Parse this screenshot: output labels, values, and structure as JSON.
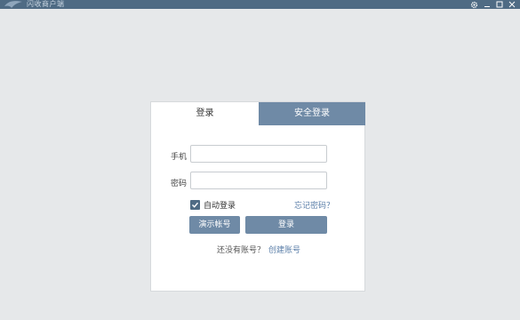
{
  "window": {
    "title": "闪收商户端",
    "controls": [
      "gear-icon",
      "minimize-icon",
      "maximize-icon",
      "close-icon"
    ]
  },
  "tabs": [
    {
      "label": "登录",
      "active": true
    },
    {
      "label": "安全登录",
      "active": false
    }
  ],
  "form": {
    "phone_label": "手机",
    "phone_value": "",
    "password_label": "密码",
    "password_value": "",
    "auto_login_label": "自动登录",
    "auto_login_checked": true,
    "forgot_label": "忘记密码？",
    "demo_button": "演示帐号",
    "login_button": "登录",
    "no_account_text": "还没有账号？",
    "create_account_link": "创建账号"
  },
  "colors": {
    "titlebar": "#4f6b84",
    "accent": "#6f8aa6",
    "link": "#5a7ea8",
    "background": "#e6e8ea"
  }
}
